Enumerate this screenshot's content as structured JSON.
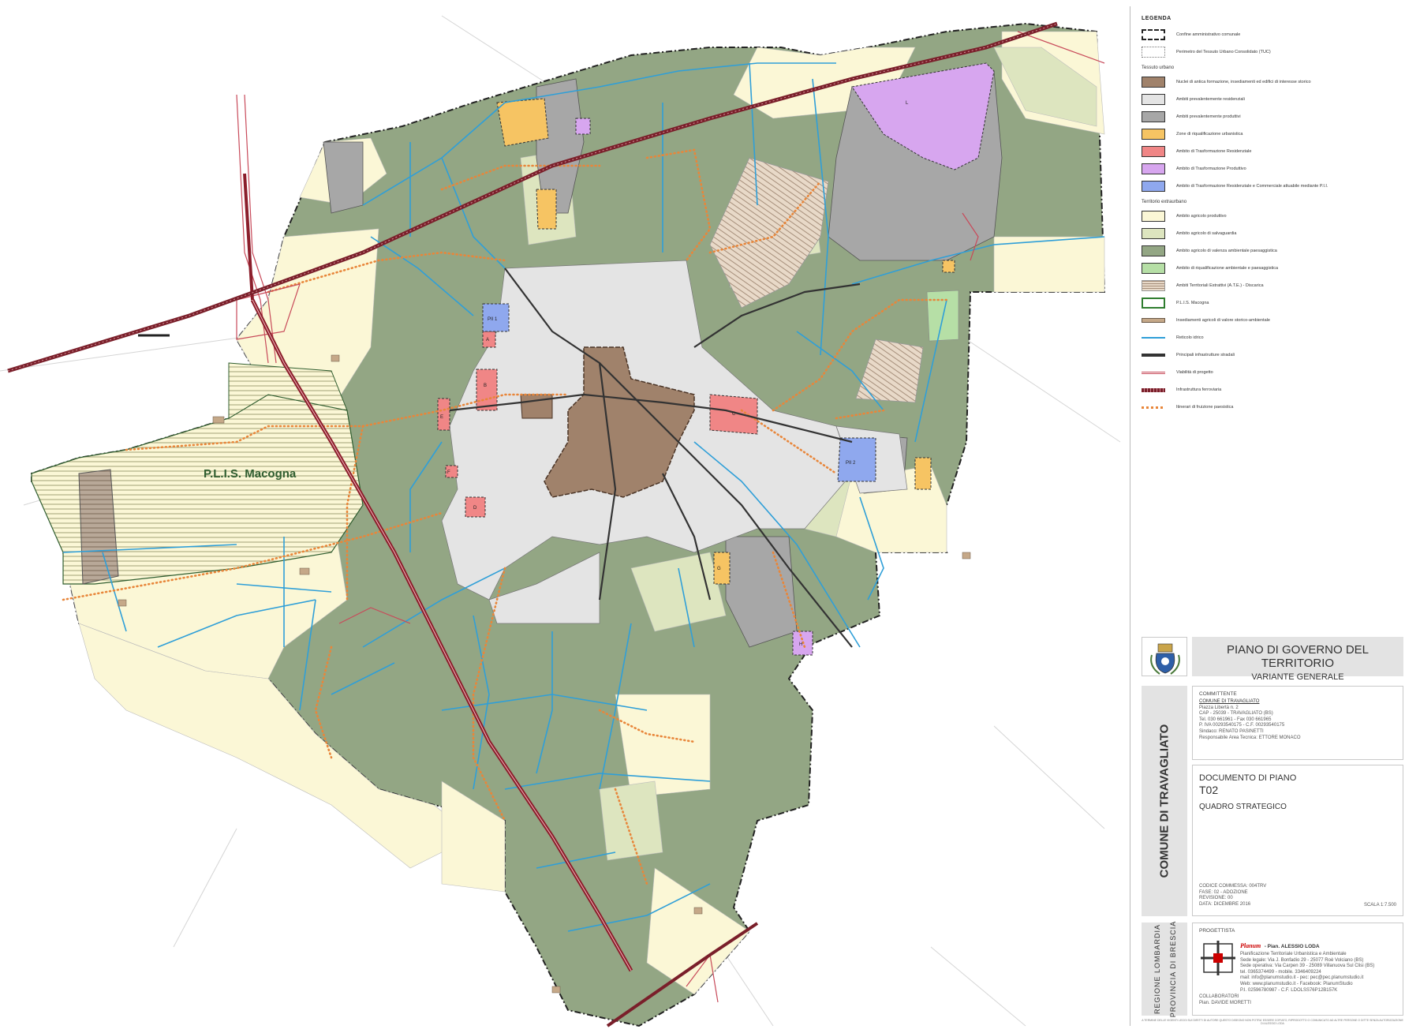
{
  "map": {
    "plis_label": "P.L.I.S. Macogna",
    "zone_letters": [
      "PII 1",
      "A",
      "B",
      "C",
      "D",
      "E",
      "F",
      "G",
      "H",
      "L",
      "PII 2"
    ]
  },
  "legend": {
    "title": "LEGENDA",
    "section_urbano": "Tessuto urbano",
    "section_extraurbano": "Territorio extraurbano",
    "items": [
      {
        "label": "Confine amministrativo comunale",
        "symbol": "boundary-dash"
      },
      {
        "label": "Perimetro del Tessuto Urbano Consolidato (TUC)",
        "symbol": "tuc-dash"
      },
      {
        "label": "Nuclei di antica formazione, insediamenti ed edifici di interesse storico",
        "color": "#a0826b"
      },
      {
        "label": "Ambiti prevalentemente residenziali",
        "color": "#e4e4e4"
      },
      {
        "label": "Ambiti prevalentemente produttivi",
        "color": "#a7a7a7"
      },
      {
        "label": "Zone di riqualificazione urbanistica",
        "color": "#f6c463"
      },
      {
        "label": "Ambito di Trasformazione Residenziale",
        "color": "#f08686"
      },
      {
        "label": "Ambito di Trasformazione Produttivo",
        "color": "#d7a6ef"
      },
      {
        "label": "Ambito di Trasformazione Residenziale e Commerciale attuabile mediante P.I.I.",
        "color": "#8fa8ee"
      },
      {
        "label": "Ambito agricolo produttivo",
        "color": "#fbf7d6"
      },
      {
        "label": "Ambito agricolo di salvaguardia",
        "color": "#dde5bf"
      },
      {
        "label": "Ambito agricolo di valenza ambientale paesaggistica",
        "color": "#93a684"
      },
      {
        "label": "Ambito di riqualificazione ambientale e paesaggistica",
        "color": "#b6dfa6"
      },
      {
        "label": "Ambiti Territoriali Estrattivi (A.T.E.) - Discarica",
        "symbol": "hatch"
      },
      {
        "label": "P.L.I.S. Macogna",
        "symbol": "plis"
      },
      {
        "label": "Insediamenti agricoli di valore storico-ambientale",
        "symbol": "farm"
      },
      {
        "label": "Reticolo idrico",
        "symbol": "water"
      },
      {
        "label": "Principali infrastrutture stradali",
        "symbol": "road"
      },
      {
        "label": "Viabilità di progetto",
        "symbol": "road-project"
      },
      {
        "label": "Infrastruttura ferroviaria",
        "symbol": "rail"
      },
      {
        "label": "Itinerari di fruizione paesistica",
        "symbol": "path"
      }
    ]
  },
  "title_block": {
    "title": "PIANO DI GOVERNO DEL TERRITORIO",
    "subtitle": "VARIANTE GENERALE",
    "comune_vertical": "COMUNE DI TRAVAGLIATO",
    "committente": {
      "heading": "COMMITTENTE",
      "name": "COMUNE DI TRAVAGLIATO",
      "lines": [
        "Piazza Libertà n. 2",
        "CAP - 25039 - TRAVAGLIATO (BS)",
        "Tel. 030 661961 - Fax 030 661965",
        "P. IVA 00293540175 - C.F. 00293540175",
        "Sindaco: RENATO PASINETTI",
        "Responsabile Area Tecnica: ETTORE MONACO"
      ]
    },
    "documento": {
      "label": "DOCUMENTO DI PIANO",
      "code": "T02",
      "name": "QUADRO STRATEGICO",
      "meta": [
        "CODICE COMMESSA: 004TRV",
        "FASE: 02 - ADOZIONE",
        "REVISIONE: 00",
        "DATA: DICEMBRE 2016"
      ],
      "scala": "SCALA 1:7.500"
    },
    "regione": "REGIONE LOMBARDIA",
    "provincia": "PROVINCIA DI BRESCIA",
    "progettista": {
      "heading": "PROGETTISTA",
      "brand": "Planum",
      "name": "- Pian. ALESSIO LODA",
      "lines": [
        "Pianificazione Territoriale Urbanistica e Ambientale",
        "Sede legale: Via J. Bonfadio 29 - 25077 Roè Volciano (BS)",
        "Sede operativa: Via Carpen 39 - 25089 Villanuova Sul Clisi (BS)",
        "tel. 0365374499 - mobile. 3346409224",
        "mail: info@planumstudio.it - pec: pec@pec.planumstudio.it",
        "Web: www.planumstudio.it - Facebook: PlanumStudio",
        "P.I. 02596780987 - C.F. LDOLSS76P12B157K"
      ],
      "collab_heading": "COLLABORATORI",
      "collab": "Pian. DAVIDE MORETTI"
    },
    "footer_note": "A TERMINE DELLE VIGENTI LEGGI SUI DIRITTI DI AUTORE QUESTO DISEGNO NON POTRA' ESSERE COPIATO, RIPRODOTTO O COMUNICATO AD ALTRE PERSONE O DITTE SENZA AUTORIZZAZIONE DI ALESSIO LODA"
  }
}
